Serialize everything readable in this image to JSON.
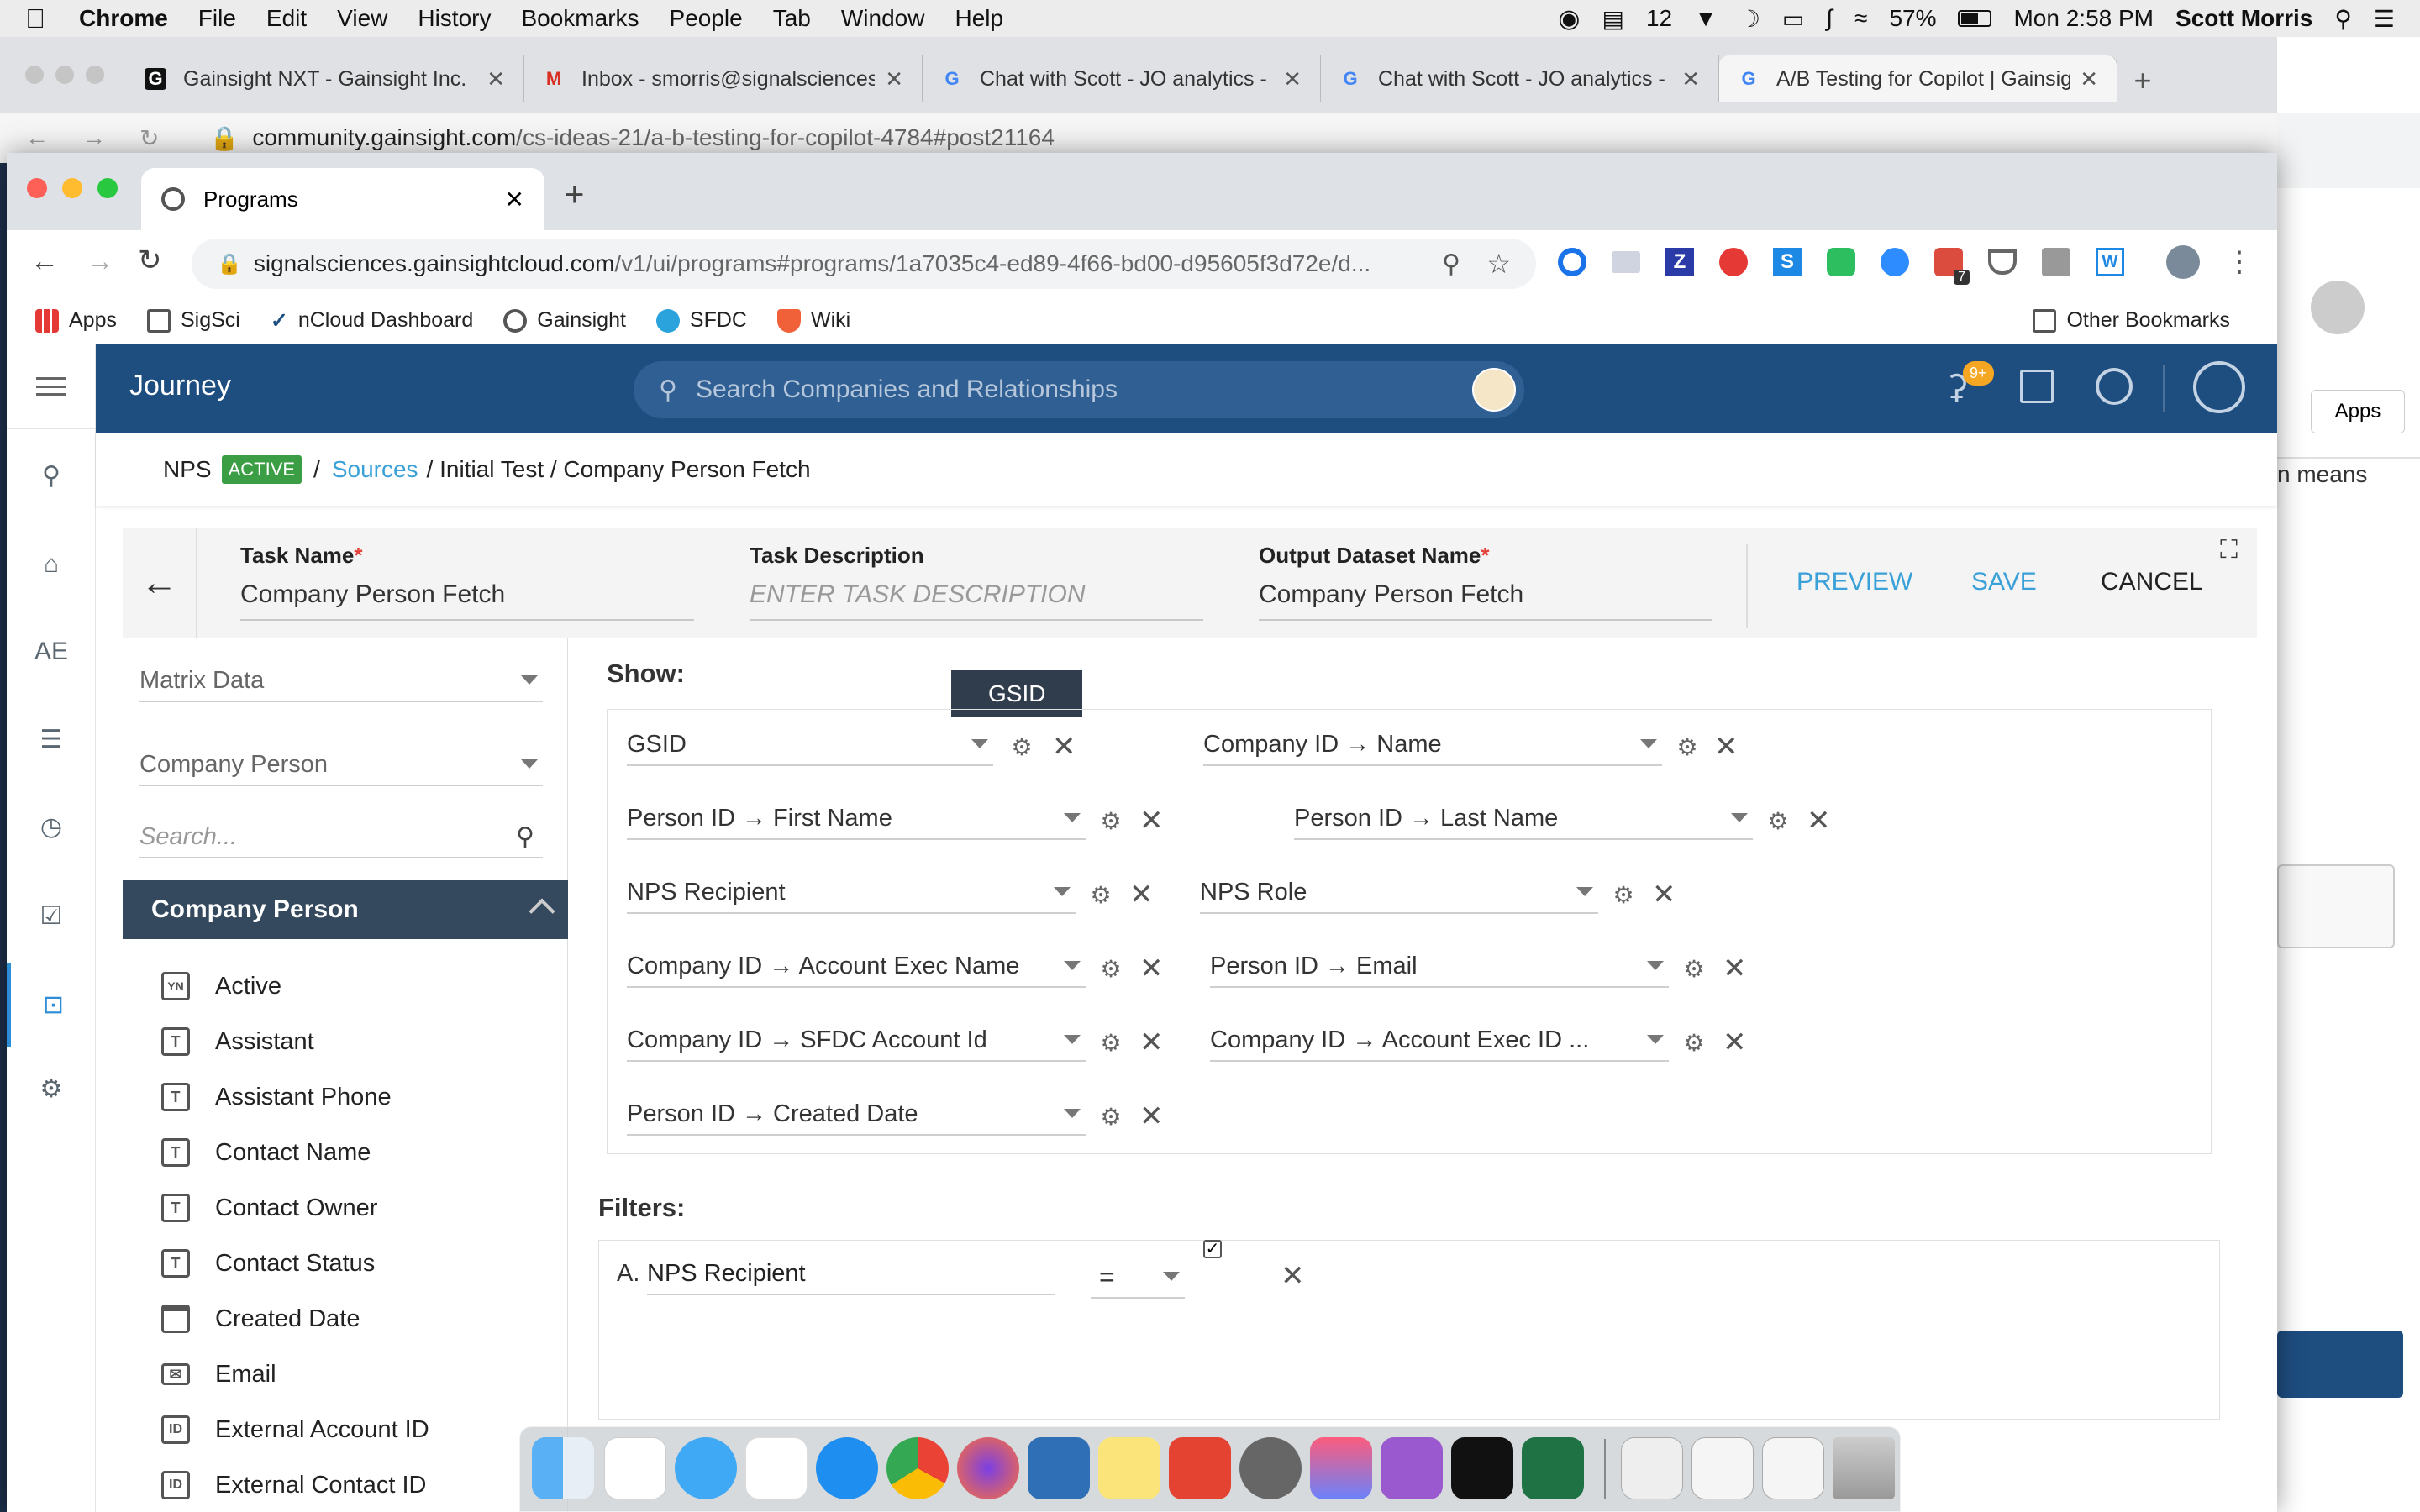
{
  "menubar": {
    "app": "Chrome",
    "items": [
      "File",
      "Edit",
      "View",
      "History",
      "Bookmarks",
      "People",
      "Tab",
      "Window",
      "Help"
    ],
    "status_count": "12",
    "battery": "57%",
    "clock": "Mon 2:58 PM",
    "user": "Scott Morris"
  },
  "bg_window": {
    "tabs": [
      {
        "label": "Gainsight NXT - Gainsight Inc.",
        "fav": "G"
      },
      {
        "label": "Inbox - smorris@signalsciences",
        "fav": "M"
      },
      {
        "label": "Chat with Scott - JO analytics -",
        "fav": "G"
      },
      {
        "label": "Chat with Scott - JO analytics -",
        "fav": "G"
      },
      {
        "label": "A/B Testing for Copilot | Gainsig",
        "fav": "G"
      }
    ],
    "url_host": "community.gainsight.com",
    "url_path": "/cs-ideas-21/a-b-testing-for-copilot-4784#post21164"
  },
  "right_pane": {
    "apps_button": "Apps",
    "text": "n means"
  },
  "window": {
    "tab_title": "Programs",
    "url_host": "signalsciences.gainsightcloud.com",
    "url_path": "/v1/ui/programs#programs/1a7035c4-ed89-4f66-bd00-d95605f3d72e/d...",
    "ext_badge": "7",
    "bookmarks": [
      "Apps",
      "SigSci",
      "nCloud Dashboard",
      "Gainsight",
      "SFDC",
      "Wiki"
    ],
    "other_bookmarks": "Other Bookmarks"
  },
  "app": {
    "title": "Journey",
    "search_placeholder": "Search Companies and Relationships",
    "notif_badge": "9+",
    "nav_ae": "AE",
    "breadcrumb": {
      "program": "NPS",
      "status": "ACTIVE",
      "sep": "/",
      "sources": "Sources",
      "rest": "/ Initial Test / Company Person Fetch"
    },
    "task": {
      "name_label": "Task Name",
      "name_value": "Company Person Fetch",
      "desc_label": "Task Description",
      "desc_placeholder": "ENTER TASK DESCRIPTION",
      "output_label": "Output Dataset Name",
      "output_value": "Company Person Fetch",
      "required_mark": "*",
      "preview": "PREVIEW",
      "save": "SAVE",
      "cancel": "CANCEL"
    },
    "source": {
      "type": "Matrix Data",
      "object": "Company Person",
      "search_placeholder": "Search...",
      "group_title": "Company Person",
      "fields": [
        {
          "icon": "YN",
          "label": "Active"
        },
        {
          "icon": "T",
          "label": "Assistant"
        },
        {
          "icon": "T",
          "label": "Assistant Phone"
        },
        {
          "icon": "T",
          "label": "Contact Name"
        },
        {
          "icon": "T",
          "label": "Contact Owner"
        },
        {
          "icon": "T",
          "label": "Contact Status"
        },
        {
          "icon": "cal",
          "label": "Created Date"
        },
        {
          "icon": "mail",
          "label": "Email"
        },
        {
          "icon": "ID",
          "label": "External Account ID"
        },
        {
          "icon": "ID",
          "label": "External Contact ID"
        }
      ]
    },
    "show": {
      "label": "Show:",
      "tooltip": "GSID",
      "fields": [
        "GSID",
        "Company ID → Name",
        "Person ID → First Name",
        "Person ID → Last Name",
        "NPS Recipient",
        "NPS Role",
        "Company ID → Account Exec Name",
        "Person ID → Email",
        "Company ID → SFDC Account Id",
        "Company ID → Account Exec ID ...",
        "Person ID → Created Date"
      ]
    },
    "filters": {
      "label": "Filters:",
      "rows": [
        {
          "letter": "A.",
          "field": "NPS Recipient",
          "operator": "=",
          "checked": true
        }
      ]
    }
  },
  "colors": {
    "app_header": "#1e4d80",
    "accent": "#2d8dd6",
    "active_badge": "#3b9e45",
    "group_header": "#34495e",
    "required": "#e5403a"
  }
}
